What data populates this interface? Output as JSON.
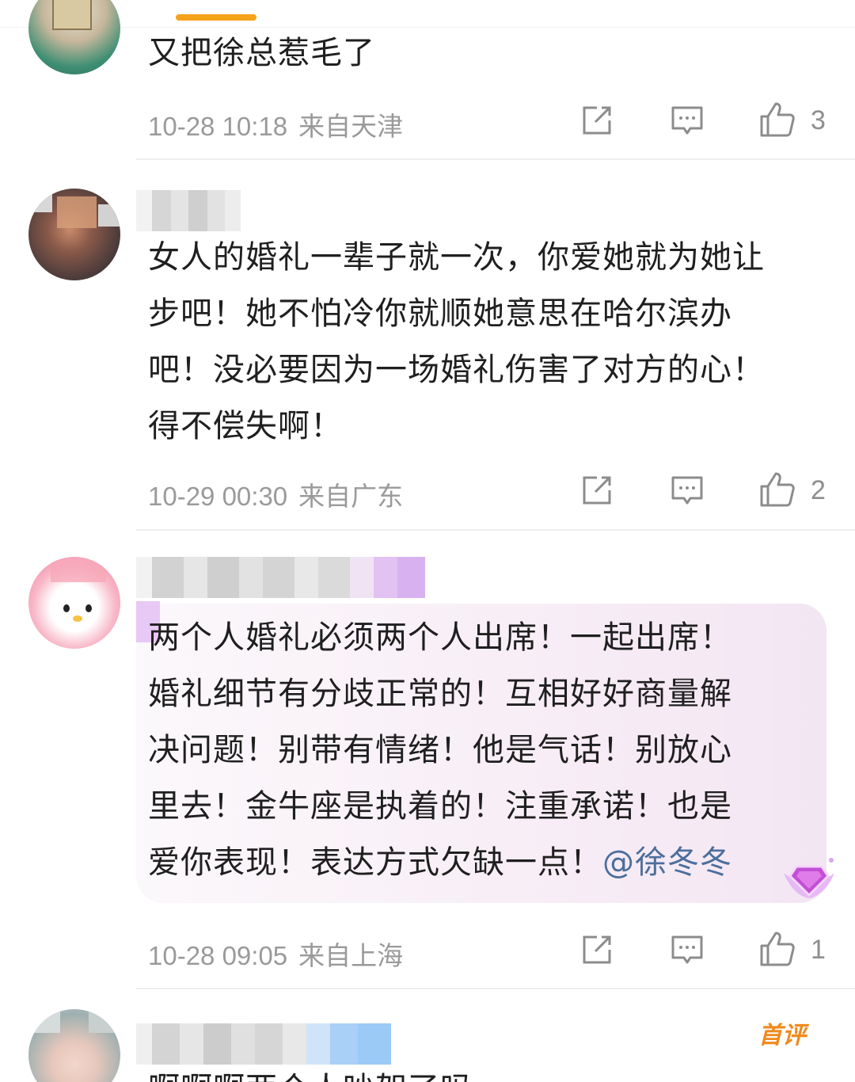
{
  "comments": [
    {
      "text_lines": [
        "又把徐总惹毛了"
      ],
      "timestamp": "10-28 10:18",
      "location": "来自天津",
      "likes": "3"
    },
    {
      "text_lines": [
        "女人的婚礼一辈子就一次，你爱她就为她让",
        "步吧！她不怕冷你就顺她意思在哈尔滨办",
        "吧！没必要因为一场婚礼伤害了对方的心！",
        "得不偿失啊！"
      ],
      "timestamp": "10-29 00:30",
      "location": "来自广东",
      "likes": "2"
    },
    {
      "text_lines": [
        "两个人婚礼必须两个人出席！一起出席！",
        "婚礼细节有分歧正常的！互相好好商量解",
        "决问题！别带有情绪！他是气话！别放心",
        "里去！金牛座是执着的！注重承诺！也是"
      ],
      "last_line_text": "爱你表现！表达方式欠缺一点！",
      "mention": "@徐冬冬",
      "timestamp": "10-28 09:05",
      "location": "来自上海",
      "likes": "1"
    },
    {
      "text_lines": [
        "啊啊啊两个人吵架了吗"
      ],
      "first_badge": "首评"
    }
  ],
  "icons": [
    "share-icon",
    "comment-icon",
    "like-icon"
  ],
  "colors": {
    "accent": "#f7a21b",
    "meta": "#9a9a9a",
    "mention": "#4c6e9c",
    "first_badge": "#f08a1c"
  }
}
